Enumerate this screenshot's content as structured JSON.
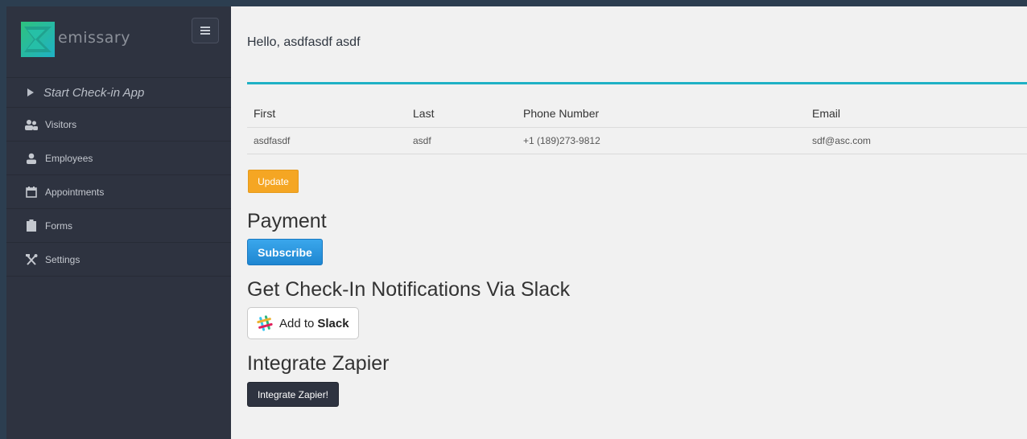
{
  "brand": {
    "name": "emissary"
  },
  "sidebar": {
    "start_label": "Start Check-in App",
    "items": [
      {
        "label": "Visitors",
        "icon": "visitors-icon"
      },
      {
        "label": "Employees",
        "icon": "user-icon"
      },
      {
        "label": "Appointments",
        "icon": "calendar-icon"
      },
      {
        "label": "Forms",
        "icon": "clipboard-icon"
      },
      {
        "label": "Settings",
        "icon": "tools-icon"
      }
    ]
  },
  "main": {
    "greeting": "Hello, asdfasdf asdf",
    "table": {
      "headers": [
        "First",
        "Last",
        "Phone Number",
        "Email"
      ],
      "rows": [
        [
          "asdfasdf",
          "asdf",
          "+1 (189)273-9812",
          "sdf@asc.com"
        ]
      ]
    },
    "update_label": "Update",
    "payment_heading": "Payment",
    "subscribe_label": "Subscribe",
    "slack_heading": "Get Check-In Notifications Via Slack",
    "slack_button": {
      "prefix": "Add to",
      "brand": "Slack"
    },
    "zapier_heading": "Integrate Zapier",
    "zapier_label": "Integrate Zapier!"
  },
  "colors": {
    "sidebar_bg": "#2e3340",
    "accent_teal": "#1fb1c5",
    "update_orange": "#f5a623",
    "subscribe_blue": "#2196e3"
  }
}
